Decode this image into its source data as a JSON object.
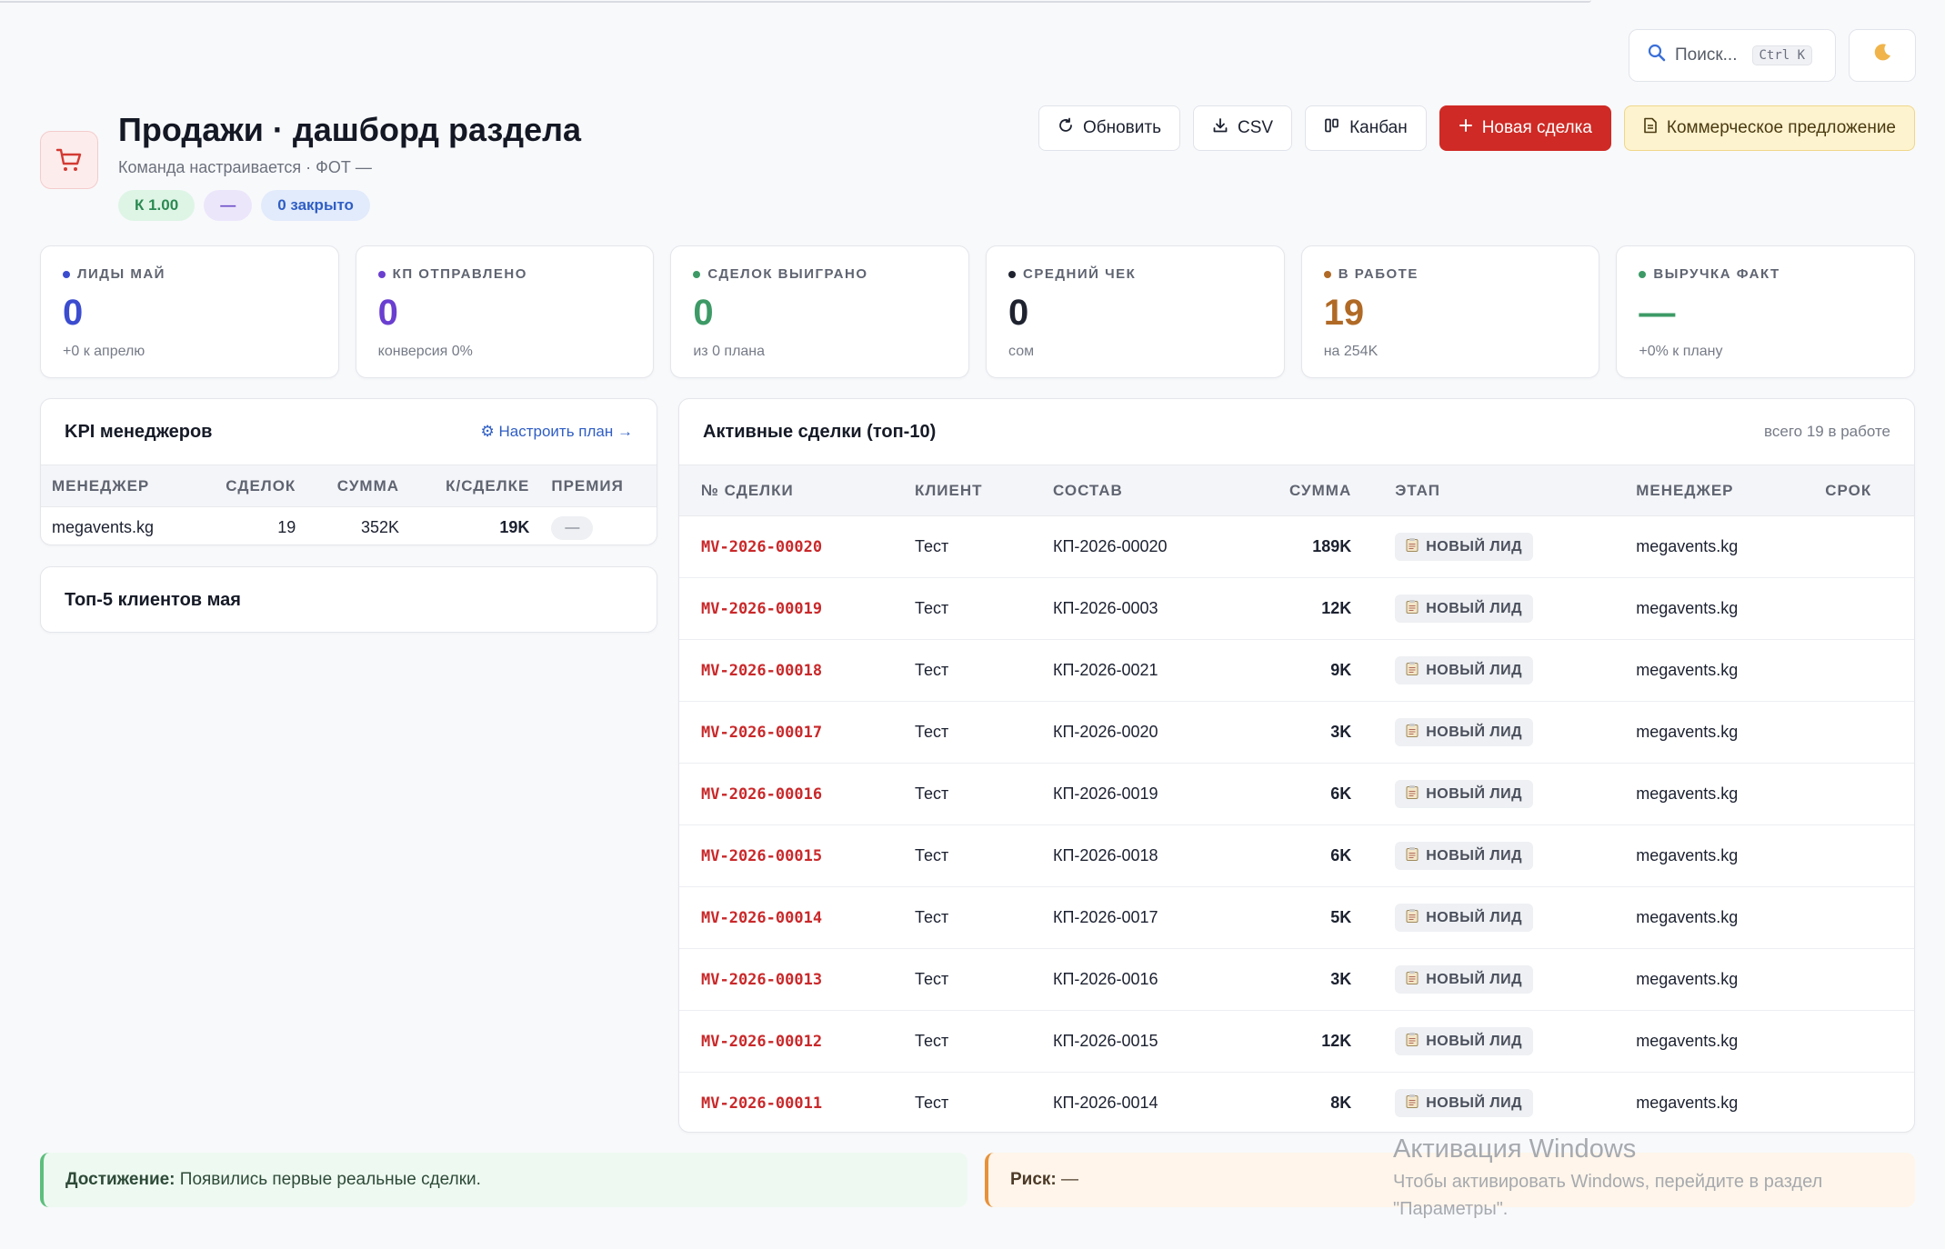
{
  "search": {
    "placeholder": "Поиск...",
    "shortcut": "Ctrl K"
  },
  "header": {
    "title": "Продажи · дашборд раздела",
    "subtitle": "Команда настраивается · ФОТ —",
    "badges": [
      "К 1.00",
      "—",
      "0 закрыто"
    ]
  },
  "actions": {
    "refresh": "Обновить",
    "csv": "CSV",
    "kanban": "Канбан",
    "new_deal": "Новая сделка",
    "proposal": "Коммерческое предложение"
  },
  "stats": [
    {
      "label": "ЛИДЫ МАЙ",
      "value": "0",
      "sub": "+0 к апрелю",
      "color": "#3b4ccf"
    },
    {
      "label": "КП ОТПРАВЛЕНО",
      "value": "0",
      "sub": "конверсия 0%",
      "color": "#6a3fd0"
    },
    {
      "label": "СДЕЛОК ВЫИГРАНО",
      "value": "0",
      "sub": "из 0 плана",
      "color": "#3d9a66"
    },
    {
      "label": "СРЕДНИЙ ЧЕК",
      "value": "0",
      "sub": "сом",
      "color": "#1f2330"
    },
    {
      "label": "В РАБОТЕ",
      "value": "19",
      "sub": "на 254K",
      "color": "#b06a26"
    },
    {
      "label": "ВЫРУЧКА ФАКТ",
      "value": "—",
      "sub": "+0% к плану",
      "color": "#3d9a66"
    }
  ],
  "kpi": {
    "title": "KPI менеджеров",
    "link": "⚙ Настроить план →",
    "columns": [
      "МЕНЕДЖЕР",
      "СДЕЛОК",
      "СУММА",
      "К/СДЕЛКЕ",
      "ПРЕМИЯ"
    ],
    "rows": [
      {
        "manager": "megavents.kg",
        "deals": "19",
        "sum": "352K",
        "per_deal": "19K",
        "bonus": "—"
      }
    ]
  },
  "top_clients": {
    "title": "Топ-5 клиентов мая"
  },
  "deals": {
    "title": "Активные сделки (топ-10)",
    "meta": "всего 19 в работе",
    "columns": [
      "№ СДЕЛКИ",
      "КЛИЕНТ",
      "СОСТАВ",
      "СУММА",
      "ЭТАП",
      "МЕНЕДЖЕР",
      "СРОК"
    ],
    "rows": [
      {
        "id": "MV-2026-00020",
        "client": "Тест",
        "comp": "КП-2026-00020",
        "sum": "189K",
        "stage": "НОВЫЙ ЛИД",
        "manager": "megavents.kg",
        "due": ""
      },
      {
        "id": "MV-2026-00019",
        "client": "Тест",
        "comp": "КП-2026-0003",
        "sum": "12K",
        "stage": "НОВЫЙ ЛИД",
        "manager": "megavents.kg",
        "due": ""
      },
      {
        "id": "MV-2026-00018",
        "client": "Тест",
        "comp": "КП-2026-0021",
        "sum": "9K",
        "stage": "НОВЫЙ ЛИД",
        "manager": "megavents.kg",
        "due": ""
      },
      {
        "id": "MV-2026-00017",
        "client": "Тест",
        "comp": "КП-2026-0020",
        "sum": "3K",
        "stage": "НОВЫЙ ЛИД",
        "manager": "megavents.kg",
        "due": ""
      },
      {
        "id": "MV-2026-00016",
        "client": "Тест",
        "comp": "КП-2026-0019",
        "sum": "6K",
        "stage": "НОВЫЙ ЛИД",
        "manager": "megavents.kg",
        "due": ""
      },
      {
        "id": "MV-2026-00015",
        "client": "Тест",
        "comp": "КП-2026-0018",
        "sum": "6K",
        "stage": "НОВЫЙ ЛИД",
        "manager": "megavents.kg",
        "due": ""
      },
      {
        "id": "MV-2026-00014",
        "client": "Тест",
        "comp": "КП-2026-0017",
        "sum": "5K",
        "stage": "НОВЫЙ ЛИД",
        "manager": "megavents.kg",
        "due": ""
      },
      {
        "id": "MV-2026-00013",
        "client": "Тест",
        "comp": "КП-2026-0016",
        "sum": "3K",
        "stage": "НОВЫЙ ЛИД",
        "manager": "megavents.kg",
        "due": ""
      },
      {
        "id": "MV-2026-00012",
        "client": "Тест",
        "comp": "КП-2026-0015",
        "sum": "12K",
        "stage": "НОВЫЙ ЛИД",
        "manager": "megavents.kg",
        "due": ""
      },
      {
        "id": "MV-2026-00011",
        "client": "Тест",
        "comp": "КП-2026-0014",
        "sum": "8K",
        "stage": "НОВЫЙ ЛИД",
        "manager": "megavents.kg",
        "due": ""
      }
    ]
  },
  "alerts": {
    "achievement_label": "Достижение:",
    "achievement_text": "Появились первые реальные сделки.",
    "risk_label": "Риск:",
    "risk_text": "—"
  },
  "watermark": {
    "title": "Активация Windows",
    "text": "Чтобы активировать Windows, перейдите в раздел \"Параметры\"."
  },
  "icons": {
    "search": "magnifier-icon",
    "theme": "moon-icon",
    "header": "cart-icon",
    "refresh": "refresh-icon",
    "csv": "download-icon",
    "kanban": "kanban-icon",
    "new_deal": "plus-icon",
    "proposal": "document-icon",
    "stage": "clipboard-icon"
  }
}
